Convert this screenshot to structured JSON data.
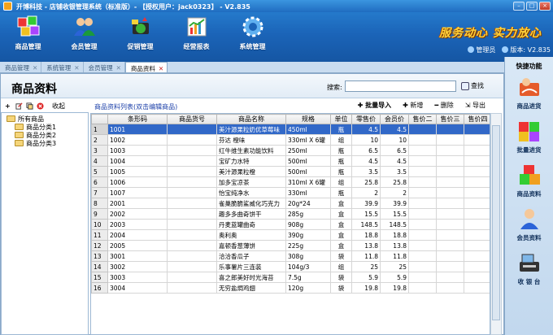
{
  "window": {
    "title": "开博科技 - 店铺收银管理系统（标准版）- 【授权用户：jack0323】 - V2.835"
  },
  "topnav": [
    {
      "label": "商品管理",
      "icon": "blocks-icon"
    },
    {
      "label": "会员管理",
      "icon": "members-icon"
    },
    {
      "label": "促销管理",
      "icon": "promotion-icon"
    },
    {
      "label": "经营报表",
      "icon": "report-icon"
    },
    {
      "label": "系统管理",
      "icon": "gear-icon"
    }
  ],
  "slogan": "服务动心 实力放心",
  "userbar": {
    "user": "管理员",
    "version": "版本: V2.835"
  },
  "tabs": [
    {
      "label": "商品管理",
      "active": false
    },
    {
      "label": "系统管理",
      "active": false
    },
    {
      "label": "会员管理",
      "active": false
    },
    {
      "label": "商品资料",
      "active": true
    }
  ],
  "page": {
    "title": "商品资料",
    "search_label": "搜索:",
    "search_value": "",
    "search_button": "查找",
    "collapse_label": "收起",
    "list_title": "商品资料列表(双击编辑商品)",
    "actions": {
      "import": "批量导入",
      "add": "新增",
      "delete": "删除",
      "export": "导出"
    }
  },
  "tree": [
    {
      "label": "所有商品",
      "level": 0
    },
    {
      "label": "商品分类1",
      "level": 1
    },
    {
      "label": "商品分类2",
      "level": 1
    },
    {
      "label": "商品分类3",
      "level": 1
    }
  ],
  "grid": {
    "columns": [
      "",
      "条形码",
      "商品货号",
      "商品名称",
      "规格",
      "单位",
      "零售价",
      "会员价",
      "售价二",
      "售价三",
      "售价四"
    ],
    "selected_row": 0,
    "rows": [
      [
        "1",
        "1001",
        "",
        "美汁源果粒奶优草莓味",
        "450ml",
        "瓶",
        "4.5",
        "4.5",
        "",
        "",
        ""
      ],
      [
        "2",
        "1002",
        "",
        "芬达 橙味",
        "330ml X 6罐",
        "组",
        "10",
        "10",
        "",
        "",
        ""
      ],
      [
        "3",
        "1003",
        "",
        "红牛维生素功能饮料",
        "250ml",
        "瓶",
        "6.5",
        "6.5",
        "",
        "",
        ""
      ],
      [
        "4",
        "1004",
        "",
        "宝矿力水特",
        "500ml",
        "瓶",
        "4.5",
        "4.5",
        "",
        "",
        ""
      ],
      [
        "5",
        "1005",
        "",
        "美汁源果粒橙",
        "500ml",
        "瓶",
        "3.5",
        "3.5",
        "",
        "",
        ""
      ],
      [
        "6",
        "1006",
        "",
        "加多宝凉茶",
        "310ml X 6罐",
        "组",
        "25.8",
        "25.8",
        "",
        "",
        ""
      ],
      [
        "7",
        "1007",
        "",
        "怡宝纯净水",
        "330ml",
        "瓶",
        "2",
        "2",
        "",
        "",
        ""
      ],
      [
        "8",
        "2001",
        "",
        "雀巢脆脆鲨威化巧克力",
        "20g*24",
        "盒",
        "39.9",
        "39.9",
        "",
        "",
        ""
      ],
      [
        "9",
        "2002",
        "",
        "趣多多曲奇饼干",
        "285g",
        "盒",
        "15.5",
        "15.5",
        "",
        "",
        ""
      ],
      [
        "10",
        "2003",
        "",
        "丹麦蓝罐曲奇",
        "908g",
        "盒",
        "148.5",
        "148.5",
        "",
        "",
        ""
      ],
      [
        "11",
        "2004",
        "",
        "奥利奥",
        "390g",
        "盒",
        "18.8",
        "18.8",
        "",
        "",
        ""
      ],
      [
        "12",
        "2005",
        "",
        "嘉顿香葱薄饼",
        "225g",
        "盒",
        "13.8",
        "13.8",
        "",
        "",
        ""
      ],
      [
        "13",
        "3001",
        "",
        "洽洽香瓜子",
        "308g",
        "袋",
        "11.8",
        "11.8",
        "",
        "",
        ""
      ],
      [
        "14",
        "3002",
        "",
        "乐事薯片三连装",
        "104g/3",
        "组",
        "25",
        "25",
        "",
        "",
        ""
      ],
      [
        "15",
        "3003",
        "",
        "喜之郎美好时光海苔",
        "7.5g",
        "袋",
        "5.9",
        "5.9",
        "",
        "",
        ""
      ],
      [
        "16",
        "3004",
        "",
        "无穷盐焗鸡翅",
        "120g",
        "袋",
        "19.8",
        "19.8",
        "",
        "",
        ""
      ]
    ]
  },
  "right_panel": {
    "title": "快捷功能",
    "items": [
      {
        "label": "商品进货",
        "icon": "stock-in-icon"
      },
      {
        "label": "批量进货",
        "icon": "batch-stock-icon"
      },
      {
        "label": "商品资料",
        "icon": "product-info-icon"
      },
      {
        "label": "会员资料",
        "icon": "member-info-icon"
      },
      {
        "label": "收 银 台",
        "icon": "cashier-icon"
      }
    ]
  },
  "colors": {
    "banner": "#1b64b8",
    "selected_row": "#3168c8",
    "slogan": "#ffd23a"
  }
}
